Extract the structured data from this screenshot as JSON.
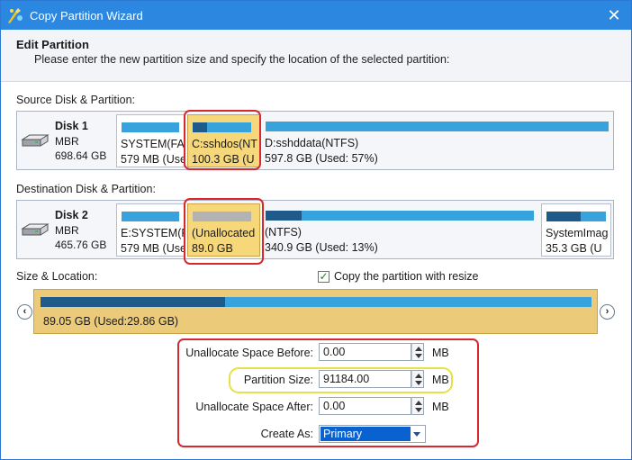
{
  "window": {
    "title": "Copy Partition Wizard",
    "close_glyph": "✕",
    "accent_color": "#2c87e0"
  },
  "header": {
    "title": "Edit Partition",
    "subtitle": "Please enter the new partition size and specify the location of the selected partition:"
  },
  "source": {
    "label": "Source Disk & Partition:",
    "disk": {
      "name": "Disk 1",
      "type": "MBR",
      "size": "698.64 GB",
      "icon": "hard-disk-icon"
    },
    "partitions": [
      {
        "name": "SYSTEM(FAT",
        "detail": "579 MB (Use",
        "used_fraction": 1.0,
        "selected": false
      },
      {
        "name": "C:sshdos(NT",
        "detail": "100.3 GB (U",
        "used_fraction": 0.25,
        "selected": true
      },
      {
        "name": "D:sshddata(NTFS)",
        "detail": "597.8 GB (Used: 57%)",
        "used_fraction": 0.0,
        "selected": false
      }
    ]
  },
  "destination": {
    "label": "Destination Disk & Partition:",
    "disk": {
      "name": "Disk 2",
      "type": "MBR",
      "size": "465.76 GB",
      "icon": "hard-disk-icon"
    },
    "partitions": [
      {
        "name": "E:SYSTEM(F",
        "detail": "579 MB (Use",
        "used_fraction": 1.0,
        "selected": false
      },
      {
        "name": "(Unallocated",
        "detail": "89.0 GB",
        "used_fraction": 0.0,
        "selected": true,
        "unallocated": true
      },
      {
        "name": "(NTFS)",
        "detail": "340.9 GB (Used: 13%)",
        "used_fraction": 0.13,
        "selected": false
      },
      {
        "name": "SystemImag",
        "detail": "35.3 GB (U",
        "used_fraction": 0.55,
        "selected": false
      }
    ]
  },
  "size_location": {
    "label": "Size & Location:",
    "copy_with_resize_label": "Copy the partition with resize",
    "copy_with_resize_checked": true,
    "bar_text": "89.05 GB (Used:29.86 GB)",
    "used_fraction": 0.335,
    "left_arrow_icon": "chevron-left-icon",
    "right_arrow_icon": "chevron-right-icon"
  },
  "fields": {
    "unallocated_before": {
      "label": "Unallocate Space Before:",
      "value": "0.00",
      "unit": "MB"
    },
    "partition_size": {
      "label": "Partition Size:",
      "value": "91184.00",
      "unit": "MB"
    },
    "unallocated_after": {
      "label": "Unallocate Space After:",
      "value": "0.00",
      "unit": "MB"
    },
    "create_as": {
      "label": "Create As:",
      "value": "Primary"
    }
  },
  "colors": {
    "highlight_red": "#d7282f",
    "highlight_yellow": "#e6e14a",
    "selected_partition": "#f6d87a",
    "bar_blue": "#37a2dc",
    "bar_used": "#1e5a8a"
  }
}
